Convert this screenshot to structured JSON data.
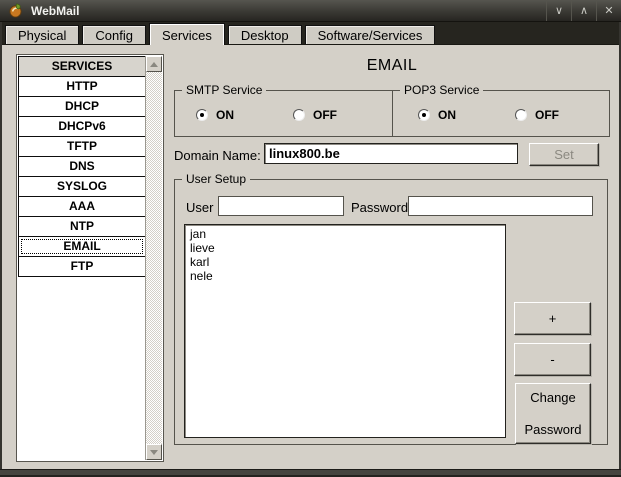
{
  "window": {
    "title": "WebMail",
    "controls": {
      "minimize": "∨",
      "maximize": "∧",
      "close": "✕"
    }
  },
  "tabs": [
    {
      "label": "Physical",
      "active": false
    },
    {
      "label": "Config",
      "active": false
    },
    {
      "label": "Services",
      "active": true
    },
    {
      "label": "Desktop",
      "active": false
    },
    {
      "label": "Software/Services",
      "active": false
    }
  ],
  "sidebar": {
    "header": "SERVICES",
    "items": [
      {
        "label": "HTTP",
        "selected": false
      },
      {
        "label": "DHCP",
        "selected": false
      },
      {
        "label": "DHCPv6",
        "selected": false
      },
      {
        "label": "TFTP",
        "selected": false
      },
      {
        "label": "DNS",
        "selected": false
      },
      {
        "label": "SYSLOG",
        "selected": false
      },
      {
        "label": "AAA",
        "selected": false
      },
      {
        "label": "NTP",
        "selected": false
      },
      {
        "label": "EMAIL",
        "selected": true
      },
      {
        "label": "FTP",
        "selected": false
      }
    ]
  },
  "main": {
    "heading": "EMAIL",
    "smtp": {
      "legend": "SMTP Service",
      "options": [
        {
          "label": "ON",
          "checked": true
        },
        {
          "label": "OFF",
          "checked": false
        }
      ]
    },
    "pop3": {
      "legend": "POP3 Service",
      "options": [
        {
          "label": "ON",
          "checked": true
        },
        {
          "label": "OFF",
          "checked": false
        }
      ]
    },
    "domain": {
      "label": "Domain Name:",
      "value": "linux800.be",
      "set_button": "Set",
      "set_enabled": false
    },
    "user_setup": {
      "legend": "User Setup",
      "user_label": "User",
      "user_value": "",
      "password_label": "Password",
      "password_value": "",
      "users": [
        "jan",
        "lieve",
        "karl",
        "nele"
      ],
      "buttons": {
        "add": "+",
        "remove": "-",
        "change_line1": "Change",
        "change_line2": "Password"
      }
    }
  },
  "colors": {
    "window_bg": "#d4d0c8",
    "titlebar": "#3a3934",
    "titlebar_text": "#f2f2ef",
    "disabled_text": "#8b8981",
    "list_bg": "#ffffff",
    "border_dark": "#23221e"
  }
}
